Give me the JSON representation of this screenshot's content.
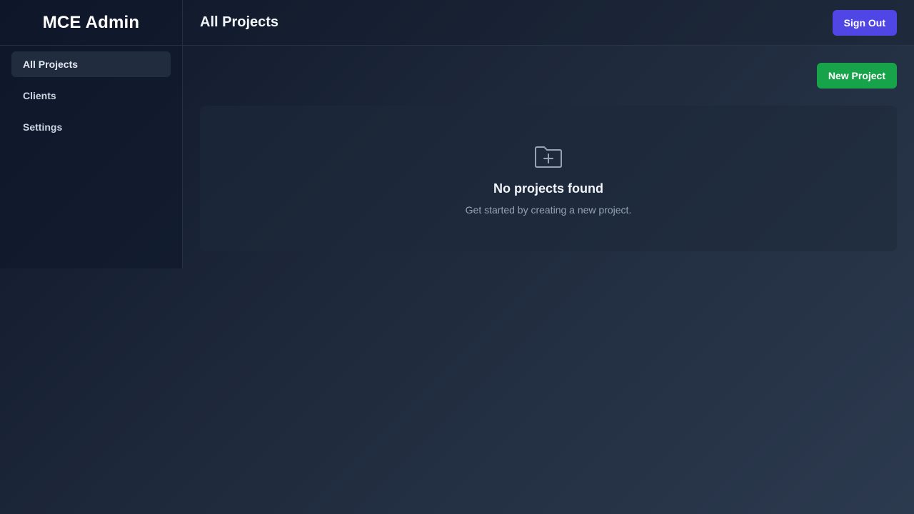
{
  "sidebar": {
    "brand": "MCE Admin",
    "items": [
      {
        "label": "All Projects",
        "active": true
      },
      {
        "label": "Clients",
        "active": false
      },
      {
        "label": "Settings",
        "active": false
      }
    ]
  },
  "header": {
    "title": "All Projects",
    "sign_out_label": "Sign Out"
  },
  "main": {
    "new_project_label": "New Project",
    "empty_state": {
      "icon": "folder-plus-icon",
      "title": "No projects found",
      "subtitle": "Get started by creating a new project."
    }
  },
  "colors": {
    "sign_out": "#4f46e5",
    "new_project": "#16a34a"
  }
}
